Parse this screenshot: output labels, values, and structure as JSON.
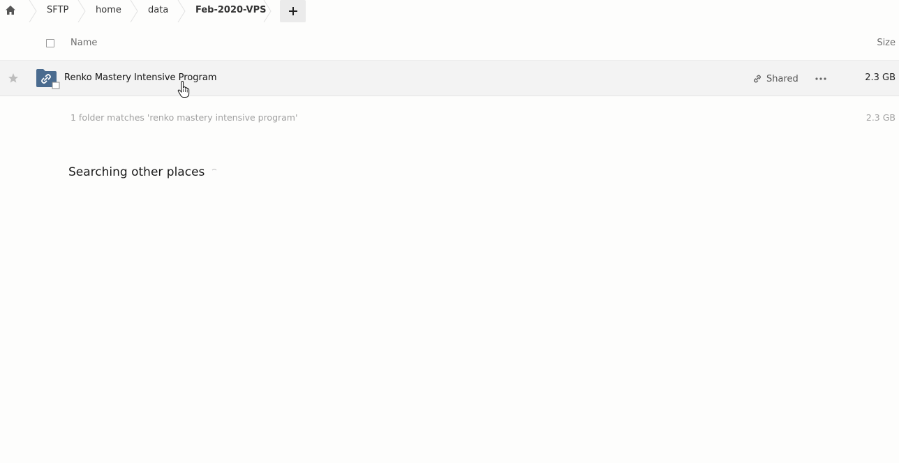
{
  "breadcrumb": {
    "home_icon": "home-icon",
    "items": [
      "SFTP",
      "home",
      "data",
      "Feb-2020-VPS"
    ],
    "add_icon": "plus-icon"
  },
  "list_header": {
    "name_label": "Name",
    "size_label": "Size"
  },
  "files": [
    {
      "name": "Renko Mastery Intensive Program",
      "icon": "shared-folder-icon",
      "share_label": "Shared",
      "size": "2.3 GB",
      "favorite": false
    }
  ],
  "summary": {
    "text": "1 folder matches 'renko mastery intensive program'",
    "size": "2.3 GB"
  },
  "other_places": {
    "title": "Searching other places"
  },
  "colors": {
    "folder": "#4a6b8f",
    "row_hover": "#f3f3f3",
    "muted_text": "#a0a0a0"
  }
}
